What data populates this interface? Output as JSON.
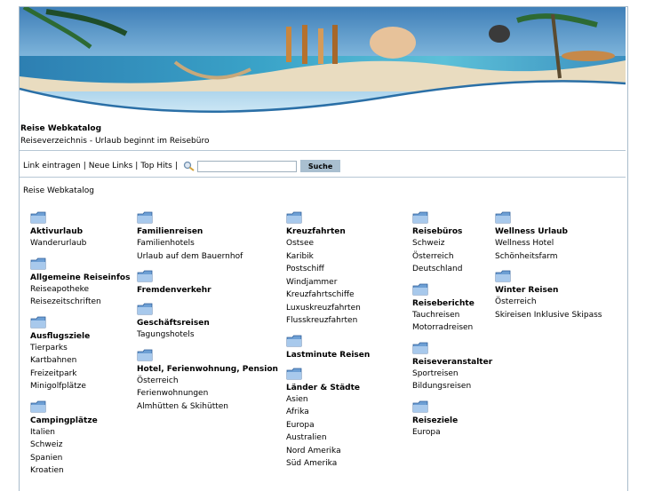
{
  "header": {
    "title": "Reise Webkatalog",
    "subtitle": "Reiseverzeichnis - Urlaub beginnt im Reisebüro"
  },
  "toolbar": {
    "link_add": "Link eintragen",
    "new_links": "Neue Links",
    "top_hits": "Top Hits",
    "separator": "|",
    "search_value": "",
    "search_button": "Suche"
  },
  "breadcrumb": "Reise Webkatalog",
  "columns": [
    {
      "categories": [
        {
          "title": "Aktivurlaub",
          "subs": [
            "Wanderurlaub"
          ]
        },
        {
          "title": "Allgemeine Reiseinfos",
          "subs": [
            "Reiseapotheke",
            "Reisezeitschriften"
          ]
        },
        {
          "title": "Ausflugsziele",
          "subs": [
            "Tierparks",
            "Kartbahnen",
            "Freizeitpark",
            "Minigolfplätze"
          ]
        },
        {
          "title": "Campingplätze",
          "subs": [
            "Italien",
            "Schweiz",
            "Spanien",
            "Kroatien"
          ]
        }
      ]
    },
    {
      "categories": [
        {
          "title": "Familienreisen",
          "subs": [
            "Familienhotels",
            "Urlaub auf dem Bauernhof"
          ]
        },
        {
          "title": "Fremdenverkehr",
          "subs": []
        },
        {
          "title": "Geschäftsreisen",
          "subs": [
            "Tagungshotels"
          ]
        },
        {
          "title": "Hotel, Ferienwohnung, Pension",
          "subs": [
            "Österreich",
            "Ferienwohnungen",
            "Almhütten & Skihütten"
          ]
        }
      ]
    },
    {
      "categories": [
        {
          "title": "Kreuzfahrten",
          "subs": [
            "Ostsee",
            "Karibik",
            "Postschiff",
            "Windjammer",
            "Kreuzfahrtschiffe",
            "Luxuskreuzfahrten",
            "Flusskreuzfahrten"
          ]
        },
        {
          "title": "Lastminute Reisen",
          "subs": []
        },
        {
          "title": "Länder & Städte",
          "subs": [
            "Asien",
            "Afrika",
            "Europa",
            "Australien",
            "Nord Amerika",
            "Süd Amerika"
          ]
        }
      ]
    },
    {
      "categories": [
        {
          "title": "Reisebüros",
          "subs": [
            "Schweiz",
            "Österreich",
            "Deutschland"
          ]
        },
        {
          "title": "Reiseberichte",
          "subs": [
            "Tauchreisen",
            "Motorradreisen"
          ]
        },
        {
          "title": "Reiseveranstalter",
          "subs": [
            "Sportreisen",
            "Bildungsreisen"
          ]
        },
        {
          "title": "Reiseziele",
          "subs": [
            "Europa"
          ]
        }
      ]
    },
    {
      "categories": [
        {
          "title": "Wellness Urlaub",
          "subs": [
            "Wellness Hotel",
            "Schönheitsfarm"
          ]
        },
        {
          "title": "Winter Reisen",
          "subs": [
            "Österreich",
            "Skireisen Inklusive Skipass"
          ]
        }
      ]
    }
  ],
  "colors": {
    "accent": "#a9bfd0",
    "border": "#a9bccb",
    "folder": "#5b8fc9"
  }
}
